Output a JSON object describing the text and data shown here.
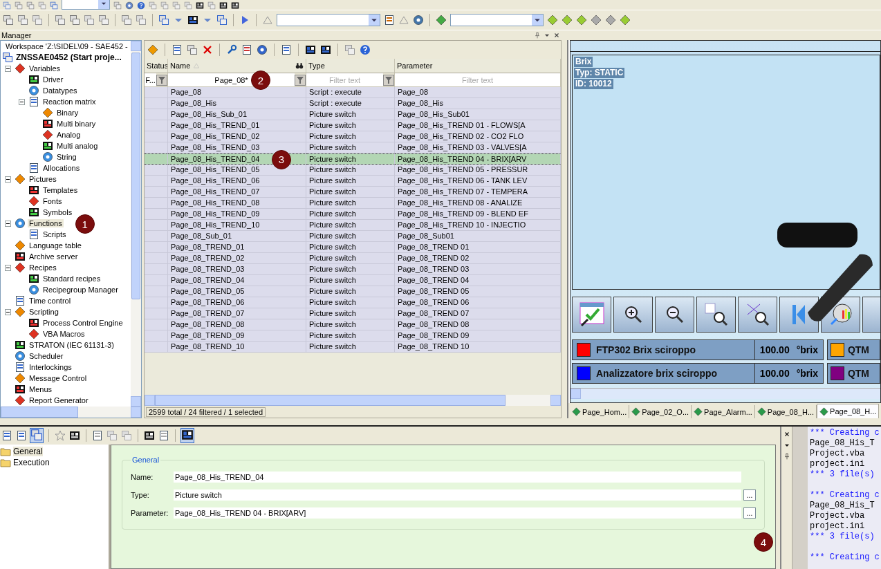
{
  "panel_title": "Manager",
  "workspace": {
    "path": "Workspace 'Z:\\SIDEL\\09 - SAE452 -",
    "project": "ZNSSAE0452 (Start proje..."
  },
  "tree": [
    {
      "label": "Variables",
      "expanded": true,
      "selected": false,
      "children": [
        {
          "label": "Driver",
          "selected": false
        },
        {
          "label": "Datatypes",
          "selected": false
        },
        {
          "label": "Reaction matrix",
          "expanded": true,
          "selected": false,
          "children": [
            {
              "label": "Binary",
              "selected": false
            },
            {
              "label": "Multi binary",
              "selected": false
            },
            {
              "label": "Analog",
              "selected": false
            },
            {
              "label": "Multi analog",
              "selected": false
            },
            {
              "label": "String",
              "selected": false
            }
          ]
        },
        {
          "label": "Allocations",
          "selected": false
        }
      ]
    },
    {
      "label": "Pictures",
      "expanded": true,
      "selected": false,
      "children": [
        {
          "label": "Templates",
          "selected": false
        },
        {
          "label": "Fonts",
          "selected": false
        },
        {
          "label": "Symbols",
          "selected": false
        }
      ]
    },
    {
      "label": "Functions",
      "expanded": true,
      "selected": true,
      "badge": "1",
      "children": [
        {
          "label": "Scripts",
          "selected": false
        }
      ]
    },
    {
      "label": "Language table",
      "selected": false
    },
    {
      "label": "Archive server",
      "selected": false
    },
    {
      "label": "Recipes",
      "expanded": true,
      "selected": false,
      "children": [
        {
          "label": "Standard recipes",
          "selected": false
        },
        {
          "label": "Recipegroup Manager",
          "selected": false
        }
      ]
    },
    {
      "label": "Time control",
      "selected": false
    },
    {
      "label": "Scripting",
      "expanded": true,
      "selected": false,
      "children": [
        {
          "label": "Process Control Engine",
          "selected": false
        },
        {
          "label": "VBA Macros",
          "selected": false
        }
      ]
    },
    {
      "label": "STRATON (IEC 61131-3)",
      "selected": false
    },
    {
      "label": "Scheduler",
      "selected": false
    },
    {
      "label": "Interlockings",
      "selected": false
    },
    {
      "label": "Message Control",
      "selected": false
    },
    {
      "label": "Menus",
      "selected": false
    },
    {
      "label": "Report Generator",
      "selected": false
    }
  ],
  "table": {
    "columns": [
      "Status",
      "Name",
      "Type",
      "Parameter"
    ],
    "filters": [
      {
        "value": "F..."
      },
      {
        "value": "Page_08*",
        "badge": "2"
      },
      {
        "placeholder": "Filter text"
      },
      {
        "placeholder": "Filter text"
      }
    ],
    "rows": [
      {
        "name": "Page_08",
        "type": "Script : execute",
        "parameter": "Page_08",
        "selected": false
      },
      {
        "name": "Page_08_His",
        "type": "Script : execute",
        "parameter": "Page_08_His",
        "selected": false
      },
      {
        "name": "Page_08_His_Sub_01",
        "type": "Picture switch",
        "parameter": "Page_08_His_Sub01",
        "selected": false
      },
      {
        "name": "Page_08_His_TREND_01",
        "type": "Picture switch",
        "parameter": "Page_08_His_TREND 01 - FLOWS[A",
        "selected": false
      },
      {
        "name": "Page_08_His_TREND_02",
        "type": "Picture switch",
        "parameter": "Page_08_His_TREND 02 - CO2 FLO",
        "selected": false
      },
      {
        "name": "Page_08_His_TREND_03",
        "type": "Picture switch",
        "parameter": "Page_08_His_TREND 03 - VALVES[A",
        "selected": false
      },
      {
        "name": "Page_08_His_TREND_04",
        "type": "Picture switch",
        "parameter": "Page_08_His_TREND 04 - BRIX[ARV",
        "selected": true,
        "badge": "3"
      },
      {
        "name": "Page_08_His_TREND_05",
        "type": "Picture switch",
        "parameter": "Page_08_His_TREND 05 - PRESSUR",
        "selected": false
      },
      {
        "name": "Page_08_His_TREND_06",
        "type": "Picture switch",
        "parameter": "Page_08_His_TREND 06 - TANK LEV",
        "selected": false
      },
      {
        "name": "Page_08_His_TREND_07",
        "type": "Picture switch",
        "parameter": "Page_08_His_TREND 07 - TEMPERA",
        "selected": false
      },
      {
        "name": "Page_08_His_TREND_08",
        "type": "Picture switch",
        "parameter": "Page_08_His_TREND 08 - ANALIZE",
        "selected": false
      },
      {
        "name": "Page_08_His_TREND_09",
        "type": "Picture switch",
        "parameter": "Page_08_His_TREND 09 - BLEND EF",
        "selected": false
      },
      {
        "name": "Page_08_His_TREND_10",
        "type": "Picture switch",
        "parameter": "Page_08_His_TREND 10 - INJECTIO",
        "selected": false
      },
      {
        "name": "Page_08_Sub_01",
        "type": "Picture switch",
        "parameter": "Page_08_Sub01",
        "selected": false
      },
      {
        "name": "Page_08_TREND_01",
        "type": "Picture switch",
        "parameter": "Page_08_TREND 01",
        "selected": false
      },
      {
        "name": "Page_08_TREND_02",
        "type": "Picture switch",
        "parameter": "Page_08_TREND 02",
        "selected": false
      },
      {
        "name": "Page_08_TREND_03",
        "type": "Picture switch",
        "parameter": "Page_08_TREND 03",
        "selected": false
      },
      {
        "name": "Page_08_TREND_04",
        "type": "Picture switch",
        "parameter": "Page_08_TREND 04",
        "selected": false
      },
      {
        "name": "Page_08_TREND_05",
        "type": "Picture switch",
        "parameter": "Page_08_TREND 05",
        "selected": false
      },
      {
        "name": "Page_08_TREND_06",
        "type": "Picture switch",
        "parameter": "Page_08_TREND 06",
        "selected": false
      },
      {
        "name": "Page_08_TREND_07",
        "type": "Picture switch",
        "parameter": "Page_08_TREND 07",
        "selected": false
      },
      {
        "name": "Page_08_TREND_08",
        "type": "Picture switch",
        "parameter": "Page_08_TREND 08",
        "selected": false
      },
      {
        "name": "Page_08_TREND_09",
        "type": "Picture switch",
        "parameter": "Page_08_TREND 09",
        "selected": false
      },
      {
        "name": "Page_08_TREND_10",
        "type": "Picture switch",
        "parameter": "Page_08_TREND 10",
        "selected": false
      }
    ],
    "status": "2599 total / 24 filtered / 1 selected"
  },
  "preview": {
    "canvas_texts": [
      "Brix",
      "Typ: STATIC",
      "ID: 10012"
    ],
    "legend": [
      {
        "color": "#ff0000",
        "label": "FTP302 Brix sciroppo",
        "value": "100.00",
        "unit": "°brix",
        "side": {
          "color": "#ffa500",
          "label": "QTM"
        }
      },
      {
        "color": "#0000ff",
        "label": "Analizzatore brix sciroppo",
        "value": "100.00",
        "unit": "°brix",
        "side": {
          "color": "#800080",
          "label": "QTM"
        }
      }
    ],
    "tabs": [
      {
        "label": "Page_Hom...",
        "selected": false
      },
      {
        "label": "Page_02_O...",
        "selected": false
      },
      {
        "label": "Page_Alarm...",
        "selected": false
      },
      {
        "label": "Page_08_H...",
        "selected": false
      },
      {
        "label": "Page_08_H...",
        "selected": true
      }
    ]
  },
  "properties": {
    "tree": [
      {
        "label": "General",
        "selected": true
      },
      {
        "label": "Execution",
        "selected": false
      }
    ],
    "group": "General",
    "fields": [
      {
        "label": "Name:",
        "value": "Page_08_His_TREND_04",
        "browse": false
      },
      {
        "label": "Type:",
        "value": "Picture switch",
        "browse": true
      },
      {
        "label": "Parameter:",
        "value": "Page_08_His_TREND 04 - BRIX[ARV]",
        "browse": true,
        "button": "..."
      }
    ],
    "badge": "4"
  },
  "output": {
    "lines": [
      {
        "kind": "info",
        "text": "*** Creating c"
      },
      {
        "kind": "plain",
        "text": "Page_08_His_T"
      },
      {
        "kind": "plain",
        "text": "Project.vba"
      },
      {
        "kind": "plain",
        "text": "project.ini"
      },
      {
        "kind": "info",
        "text": "*** 3 file(s)"
      },
      {
        "kind": "gap"
      },
      {
        "kind": "info",
        "text": "*** Creating c"
      },
      {
        "kind": "plain",
        "text": "Page_08_His_T"
      },
      {
        "kind": "plain",
        "text": "Project.vba"
      },
      {
        "kind": "plain",
        "text": "project.ini"
      },
      {
        "kind": "info",
        "text": "*** 3 file(s)"
      },
      {
        "kind": "gap"
      },
      {
        "kind": "info",
        "text": "*** Creating c"
      }
    ]
  }
}
